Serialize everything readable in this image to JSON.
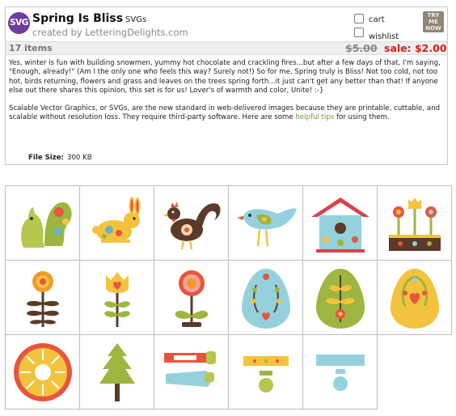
{
  "product": {
    "badge_text": "SVG",
    "title": "Spring Is Bliss",
    "kind": "SVGs",
    "creator": "created by LetteringDelights.com",
    "cart_label": "cart",
    "wishlist_label": "wishlist",
    "try_line1": "TRY",
    "try_line2": "ME",
    "try_line3": "NOW",
    "items_count": "17 items",
    "old_price": "$5.00",
    "sale_price": "sale: $2.00",
    "desc1": "Yes, winter is fun with building snowmen, yummy hot chocolate and crackling fires...but after a few days of that, I'm saying, \"Enough, already!\" (Am I the only one who feels this way? Surely not!) So for me, Spring truly is Bliss! Not too cold, not too hot, birds returning, flowers and grass and leaves on the trees spring forth...it just can't get any better than that! If anyone else out there shares this opinion, this set is for us! Lover's of warmth and color, Unite! :-}",
    "desc2_before": "Scalable Vector Graphics, or SVGs, are the new standard in web-delivered images because they are printable, cuttable, and scalable without resolution loss. They require third-party software. Here are some ",
    "desc2_link": "helpful tips",
    "desc2_after": " for using them.",
    "file_size_label": "File Size:",
    "file_size_value": "300 KB"
  },
  "thumbnails": [
    {
      "icon": "squirrel-icon"
    },
    {
      "icon": "bunny-icon"
    },
    {
      "icon": "rooster-icon"
    },
    {
      "icon": "bird-icon"
    },
    {
      "icon": "birdhouse-icon"
    },
    {
      "icon": "flower-planter-icon"
    },
    {
      "icon": "flower-orange-icon"
    },
    {
      "icon": "flower-tulip-icon"
    },
    {
      "icon": "flower-pink-icon"
    },
    {
      "icon": "egg-blue-icon"
    },
    {
      "icon": "egg-green-icon"
    },
    {
      "icon": "egg-yellow-icon"
    },
    {
      "icon": "sun-icon"
    },
    {
      "icon": "tree-icon"
    },
    {
      "icon": "birdhouse-cut-pieces-icon"
    },
    {
      "icon": "birdhouse-yellow-cut-pieces-icon"
    },
    {
      "icon": "birdhouse-blue-cut-pieces-icon"
    }
  ],
  "colors": {
    "badge": "#6b3fa0",
    "sale": "#d42020",
    "link": "#6a9a3a"
  }
}
